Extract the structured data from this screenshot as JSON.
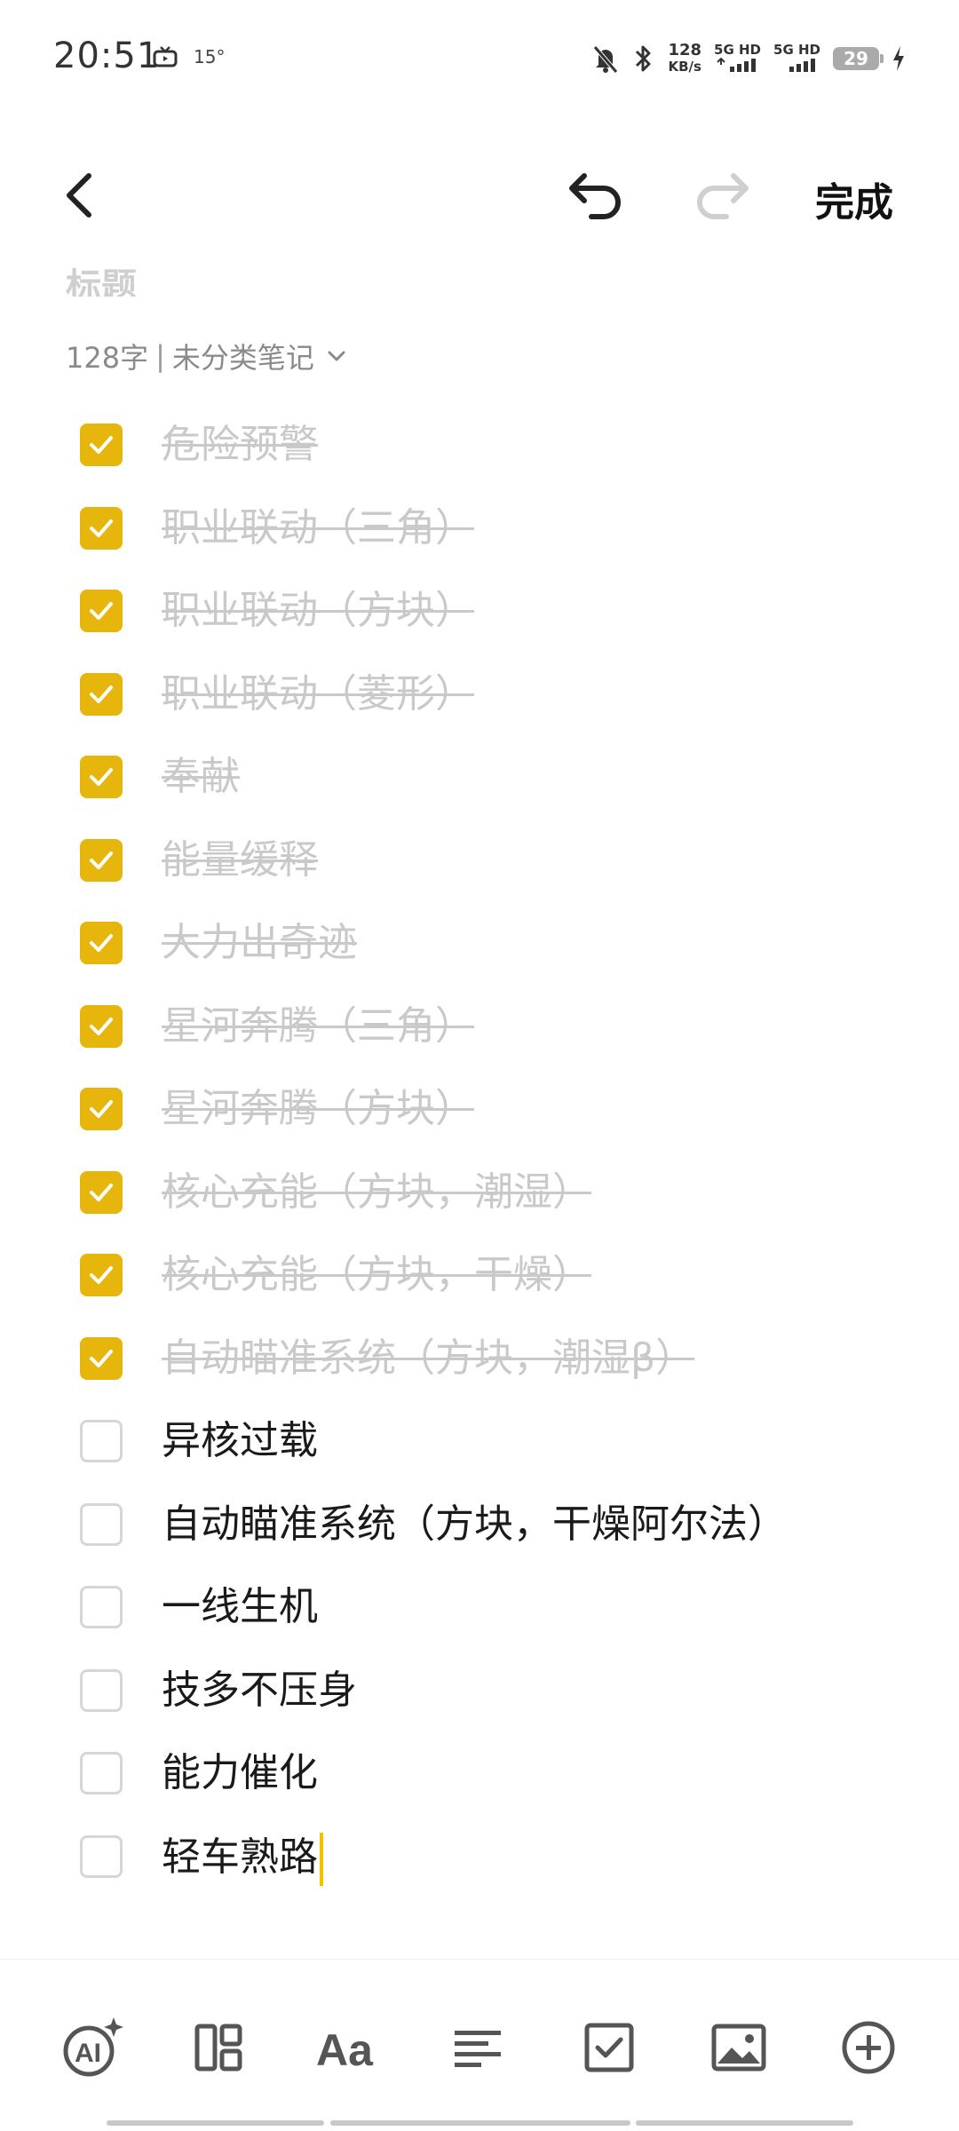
{
  "status_bar": {
    "time": "20:51",
    "temperature": "15°",
    "speed_value": "128",
    "speed_unit": "KB/s",
    "sim1": "5G HD",
    "sim2": "5G HD",
    "battery": "29"
  },
  "toolbar": {
    "done_label": "完成"
  },
  "note": {
    "title": "标题",
    "word_count": "128字",
    "separator": "|",
    "category": "未分类笔记"
  },
  "checklist": [
    {
      "text": "危险预警",
      "checked": true
    },
    {
      "text": "职业联动（三角）",
      "checked": true
    },
    {
      "text": "职业联动（方块）",
      "checked": true
    },
    {
      "text": "职业联动（菱形）",
      "checked": true
    },
    {
      "text": "奉献",
      "checked": true
    },
    {
      "text": "能量缓释",
      "checked": true
    },
    {
      "text": "大力出奇迹",
      "checked": true
    },
    {
      "text": "星河奔腾（三角）",
      "checked": true
    },
    {
      "text": "星河奔腾（方块）",
      "checked": true
    },
    {
      "text": "核心充能（方块，潮湿）",
      "checked": true
    },
    {
      "text": "核心充能（方块，干燥）",
      "checked": true
    },
    {
      "text": "自动瞄准系统（方块，潮湿β）",
      "checked": true
    },
    {
      "text": "异核过载",
      "checked": false
    },
    {
      "text": "自动瞄准系统（方块，干燥阿尔法）",
      "checked": false
    },
    {
      "text": "一线生机",
      "checked": false
    },
    {
      "text": "技多不压身",
      "checked": false
    },
    {
      "text": "能力催化",
      "checked": false
    },
    {
      "text": "轻车熟路",
      "checked": false
    }
  ],
  "bottom_tools": [
    {
      "name": "ai-assistant",
      "icon": "ai-sparkle-icon"
    },
    {
      "name": "layout",
      "icon": "layout-grid-icon"
    },
    {
      "name": "text-format",
      "icon": "font-format-icon"
    },
    {
      "name": "paragraph",
      "icon": "align-lines-icon"
    },
    {
      "name": "checklist",
      "icon": "checkbox-icon"
    },
    {
      "name": "image",
      "icon": "image-icon"
    },
    {
      "name": "insert",
      "icon": "plus-circle-icon"
    }
  ],
  "colors": {
    "accent": "#e7b60c",
    "caret": "#f2c400",
    "done_text": "#c9c9c9",
    "meta_text": "#8a8a8a"
  }
}
